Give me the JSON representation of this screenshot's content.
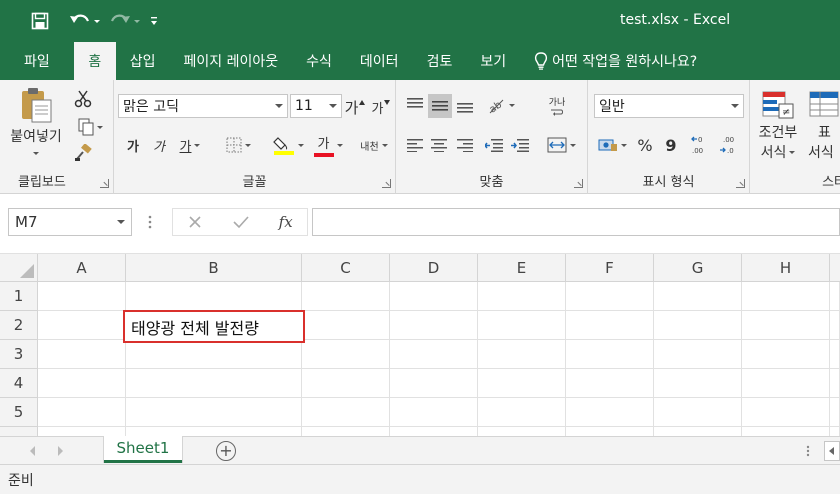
{
  "window": {
    "title": "test.xlsx  -  Excel"
  },
  "tabs": [
    {
      "label": "파일"
    },
    {
      "label": "홈"
    },
    {
      "label": "삽입"
    },
    {
      "label": "페이지 레이아웃"
    },
    {
      "label": "수식"
    },
    {
      "label": "데이터"
    },
    {
      "label": "검토"
    },
    {
      "label": "보기"
    }
  ],
  "tell_me": {
    "text": "어떤 작업을 원하시나요?"
  },
  "ribbon": {
    "clipboard": {
      "label": "클립보드",
      "paste_label": "붙여넣기"
    },
    "font": {
      "label": "글꼴",
      "font_name": "맑은 고딕",
      "font_size": "11",
      "grow_label": "가",
      "shrink_label": "가",
      "bold_label": "가",
      "italic_label": "가",
      "underline_label": "가",
      "font_color_label": "가",
      "phonetic_label": "내천",
      "highlight_color": "#ffff00",
      "font_color": "#e81123"
    },
    "alignment": {
      "label": "맞춤",
      "wrap_label": "가나"
    },
    "number": {
      "label": "표시 형식",
      "format": "일반",
      "percent_label": "%",
      "comma_label": "9"
    },
    "styles": {
      "label": "스타",
      "conditional_line1": "조건부",
      "conditional_line2": "서식",
      "table_line1": "표",
      "table_line2": "서식"
    }
  },
  "formula_bar": {
    "name_box": "M7",
    "fx_label": "fx",
    "content": ""
  },
  "grid": {
    "columns": [
      "A",
      "B",
      "C",
      "D",
      "E",
      "F",
      "G",
      "H"
    ],
    "rows": [
      "1",
      "2",
      "3",
      "4",
      "5"
    ],
    "cells": {
      "B2": "태양광 전체 발전량"
    }
  },
  "sheets": [
    {
      "name": "Sheet1",
      "active": true
    }
  ],
  "status": {
    "text": "준비"
  },
  "colors": {
    "accent": "#217346",
    "highlight_border": "#d9302c"
  }
}
